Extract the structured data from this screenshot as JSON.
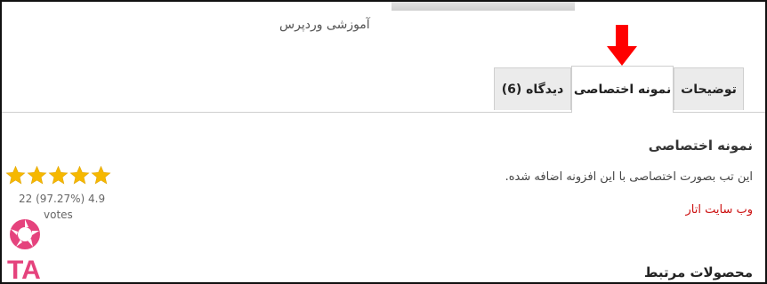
{
  "product": {
    "title": "آموزشی وردپرس"
  },
  "tabs": [
    {
      "label": "توضیحات"
    },
    {
      "label": "نمونه اختصاصی"
    },
    {
      "label": "دیدگاه (6)"
    }
  ],
  "active_tab": "نمونه اختصاصی",
  "panel": {
    "heading": "نمونه اختصاصی",
    "text": "این تب بصورت اختصاصی با این افزونه اضافه شده.",
    "link": "وب سایت اتار"
  },
  "rating": {
    "stars_filled": 5,
    "stars_total": 5,
    "summary": "22 (97.27%) 4.9",
    "votes_label": "votes"
  },
  "logo": {
    "text": "TA"
  },
  "related": {
    "heading": "محصولات مرتبط"
  },
  "colors": {
    "arrow": "#ff0000",
    "star": "#f6b800",
    "link": "#cc1111",
    "logo": "#e5437d"
  },
  "icons": {
    "arrow": "arrow-down-icon",
    "star": "star-icon",
    "logo": "camera-aperture-icon"
  }
}
